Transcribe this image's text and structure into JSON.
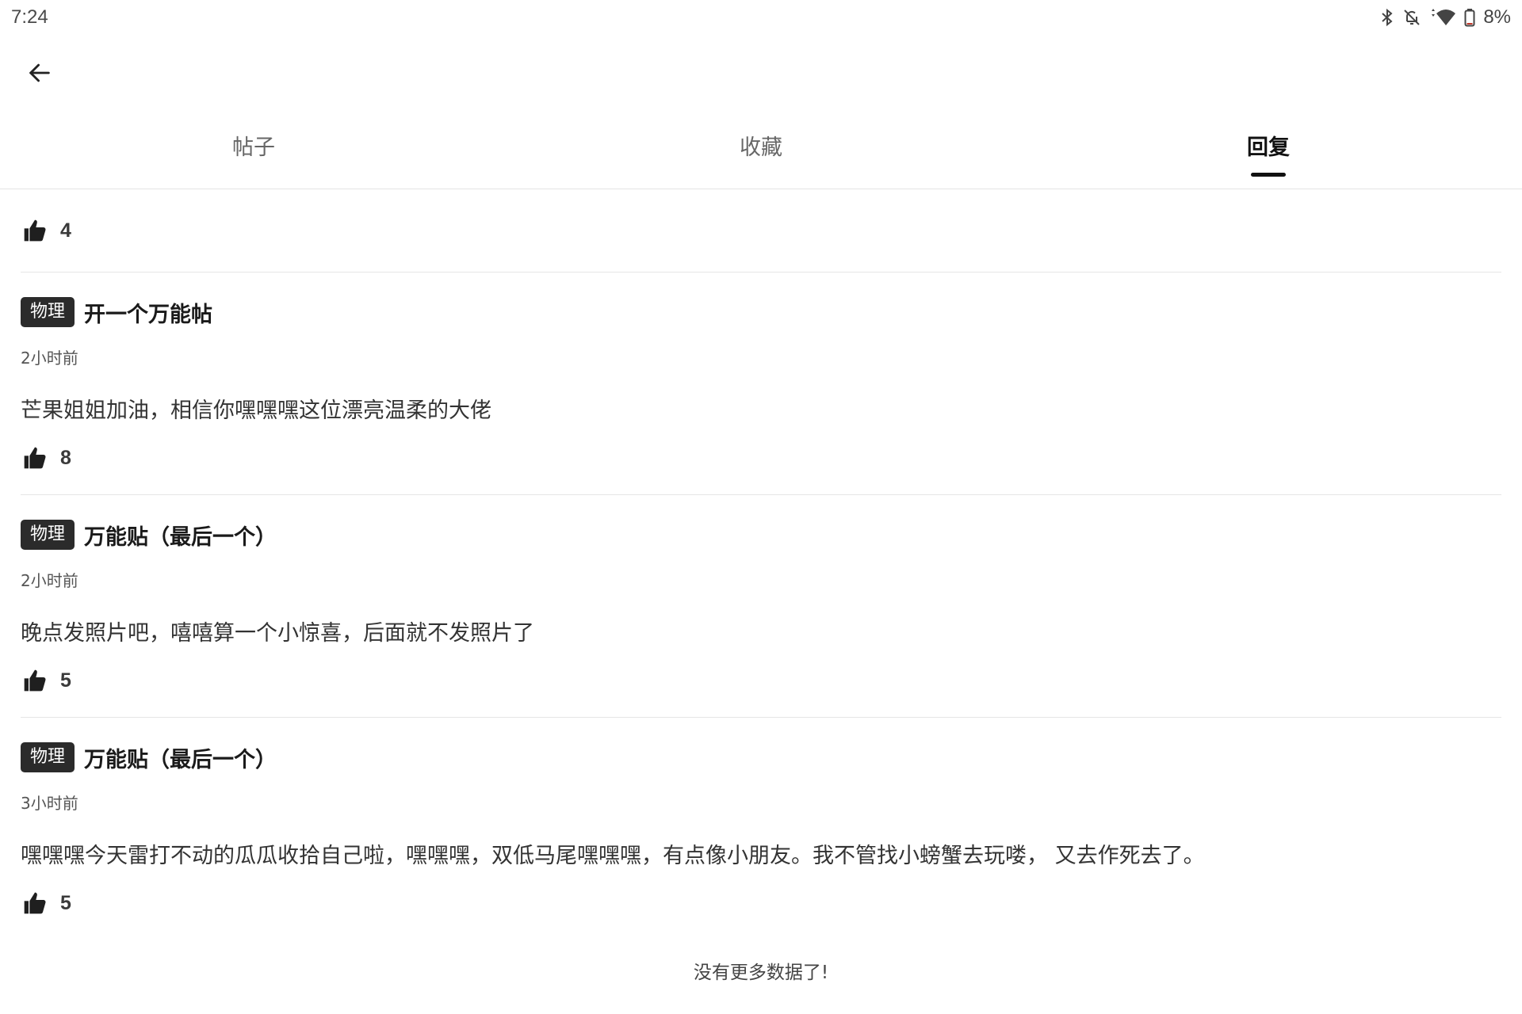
{
  "status_bar": {
    "time": "7:24",
    "battery": "8%",
    "icons": [
      "bluetooth-icon",
      "notifications-off-icon",
      "wifi-icon",
      "battery-icon"
    ]
  },
  "app_bar": {
    "back_icon": "arrow-back-icon"
  },
  "tabs": [
    {
      "label": "帖子",
      "active": false
    },
    {
      "label": "收藏",
      "active": false
    },
    {
      "label": "回复",
      "active": true
    }
  ],
  "first_item": {
    "likes": "4"
  },
  "replies": [
    {
      "tag": "物理",
      "title": "开一个万能帖",
      "time": "2小时前",
      "text": "芒果姐姐加油，相信你嘿嘿嘿这位漂亮温柔的大佬",
      "likes": "8"
    },
    {
      "tag": "物理",
      "title": "万能贴（最后一个）",
      "time": "2小时前",
      "text": "晚点发照片吧，嘻嘻算一个小惊喜，后面就不发照片了",
      "likes": "5"
    },
    {
      "tag": "物理",
      "title": "万能贴（最后一个）",
      "time": "3小时前",
      "text": "嘿嘿嘿今天雷打不动的瓜瓜收拾自己啦，嘿嘿嘿，双低马尾嘿嘿嘿，有点像小朋友。我不管找小螃蟹去玩喽， 又去作死去了。",
      "likes": "5"
    }
  ],
  "footer": {
    "no_more": "没有更多数据了!"
  },
  "colors": {
    "text_primary": "#1a1a1a",
    "tag_bg": "#2b2b2b",
    "divider": "#e6e6e6"
  }
}
